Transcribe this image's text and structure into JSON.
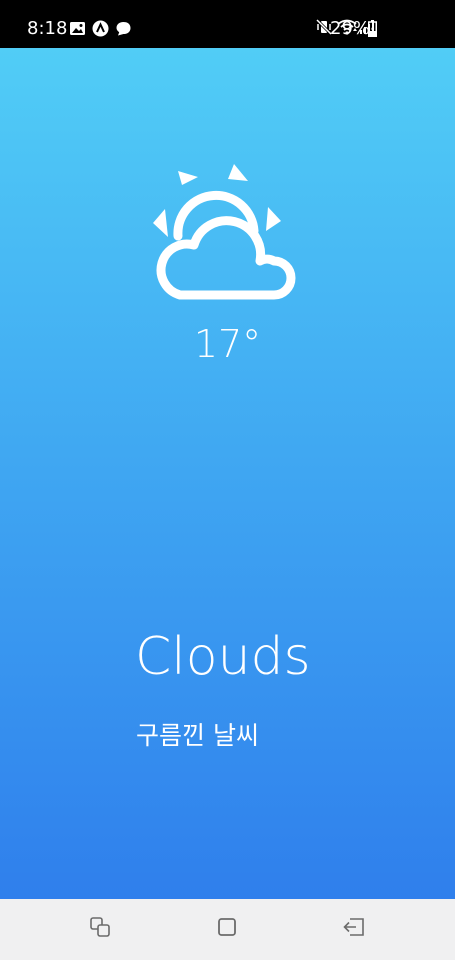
{
  "status_bar": {
    "time": "8:18",
    "left_icons": [
      "gallery-icon",
      "app-notification-icon",
      "chat-bubble-icon"
    ],
    "right_icons": [
      "mute-vibrate-icon",
      "wifi-icon",
      "signal-icon"
    ],
    "battery": "29%"
  },
  "weather": {
    "icon": "partly-cloudy-icon",
    "temperature": "17°",
    "condition": "Clouds",
    "description": "구름낀 날씨"
  },
  "colors": {
    "gradient_top": "#51cdf6",
    "gradient_bottom": "#2f7fec",
    "text": "#ffffff",
    "nav_background": "#f0f0f1"
  },
  "nav_bar": {
    "buttons": [
      "recent-apps-icon",
      "home-icon",
      "back-icon"
    ]
  }
}
